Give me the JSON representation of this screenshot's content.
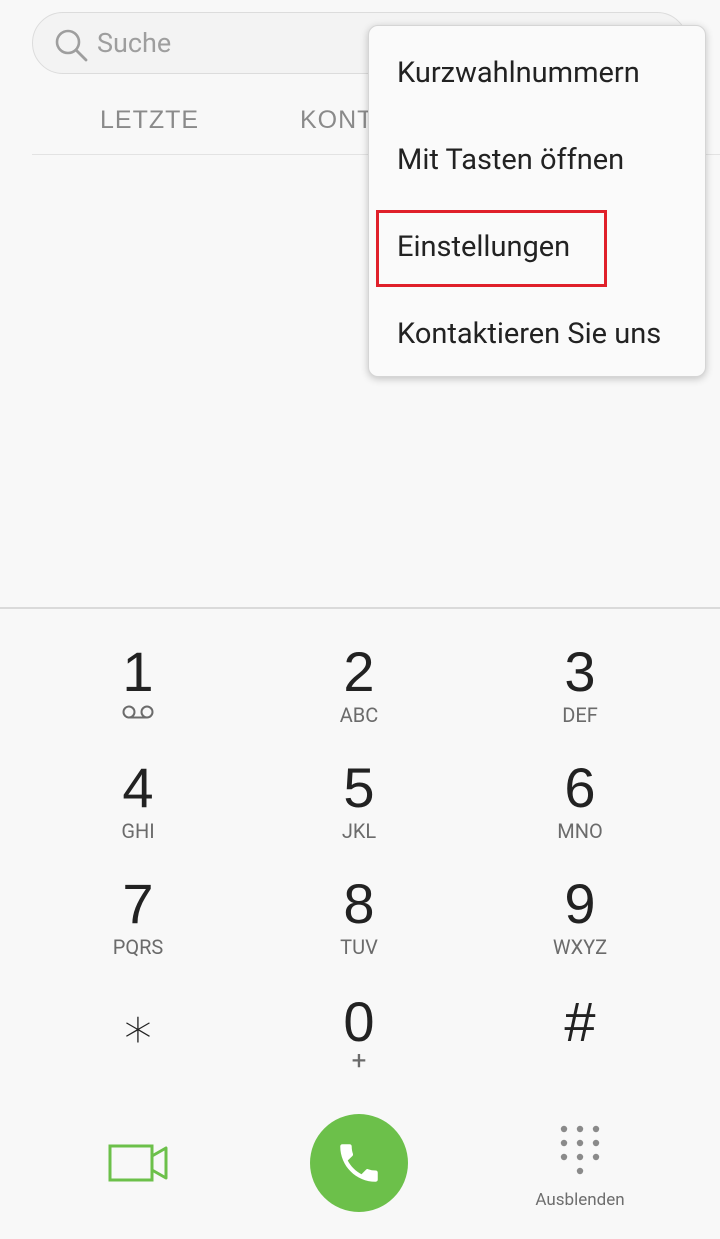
{
  "search": {
    "placeholder": "Suche"
  },
  "tabs": {
    "recent": "LETZTE",
    "contacts": "KONTA"
  },
  "menu": {
    "items": [
      "Kurzwahlnummern",
      "Mit Tasten öffnen",
      "Einstellungen",
      "Kontaktieren Sie uns"
    ],
    "highlighted_item": "Einstellungen"
  },
  "dialpad": {
    "keys": [
      {
        "digit": "1",
        "letters": "",
        "icon": "voicemail-icon"
      },
      {
        "digit": "2",
        "letters": "ABC"
      },
      {
        "digit": "3",
        "letters": "DEF"
      },
      {
        "digit": "4",
        "letters": "GHI"
      },
      {
        "digit": "5",
        "letters": "JKL"
      },
      {
        "digit": "6",
        "letters": "MNO"
      },
      {
        "digit": "7",
        "letters": "PQRS"
      },
      {
        "digit": "8",
        "letters": "TUV"
      },
      {
        "digit": "9",
        "letters": "WXYZ"
      },
      {
        "digit": "⁎",
        "letters": ""
      },
      {
        "digit": "0",
        "letters": "+"
      },
      {
        "digit": "#",
        "letters": ""
      }
    ]
  },
  "bottom": {
    "video_icon": "video-call-icon",
    "call_icon": "phone-icon",
    "hide_label": "Ausblenden"
  },
  "colors": {
    "accent_green": "#6cc04a",
    "highlight_red": "#e0202a",
    "background": "#f8f8f8"
  }
}
